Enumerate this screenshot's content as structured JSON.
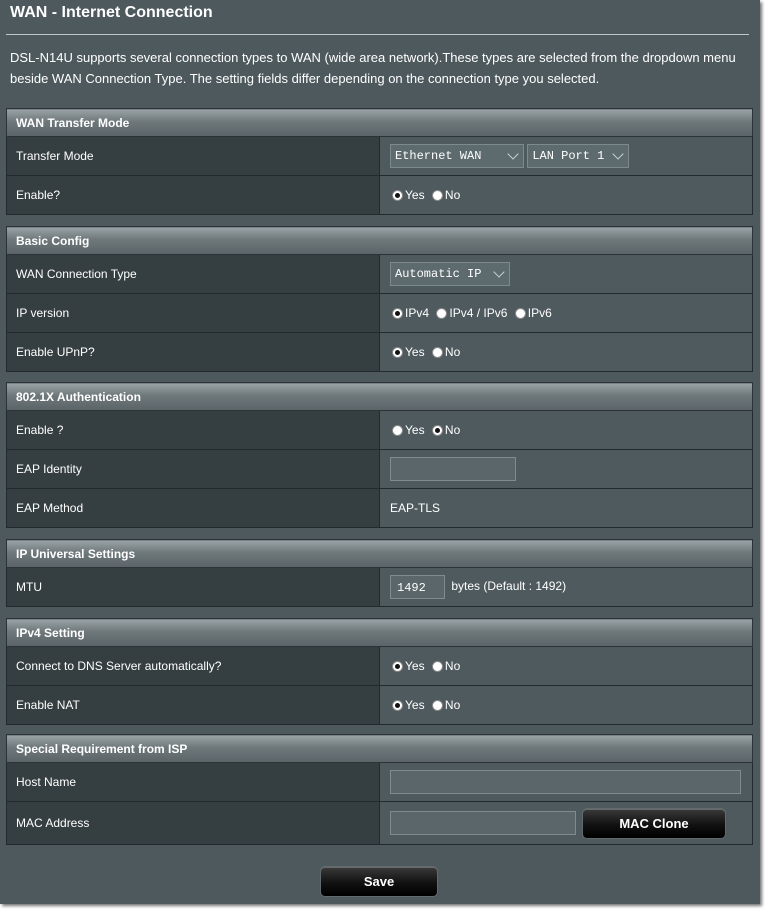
{
  "page": {
    "title": "WAN - Internet Connection",
    "description": "DSL-N14U supports several connection types to WAN (wide area network).These types are selected from the dropdown menu beside WAN Connection Type. The setting fields differ depending on the connection type you selected."
  },
  "wan_transfer_mode": {
    "header": "WAN Transfer Mode",
    "transfer_mode_label": "Transfer Mode",
    "transfer_mode_value": "Ethernet WAN",
    "port_value": "LAN Port 1",
    "enable_label": "Enable?",
    "enable_selected": "Yes"
  },
  "basic_config": {
    "header": "Basic Config",
    "wan_type_label": "WAN Connection Type",
    "wan_type_value": "Automatic IP",
    "ip_version_label": "IP version",
    "ip_version_selected": "IPv4",
    "upnp_label": "Enable UPnP?",
    "upnp_selected": "Yes"
  },
  "auth_8021x": {
    "header": "802.1X Authentication",
    "enable_label": "Enable ?",
    "enable_selected": "No",
    "eap_identity_label": "EAP Identity",
    "eap_identity_value": "",
    "eap_method_label": "EAP Method",
    "eap_method_value": "EAP-TLS"
  },
  "ip_universal": {
    "header": "IP Universal Settings",
    "mtu_label": "MTU",
    "mtu_value": "1492",
    "mtu_hint": "bytes (Default : 1492)"
  },
  "ipv4_setting": {
    "header": "IPv4 Setting",
    "dns_auto_label": "Connect to DNS Server automatically?",
    "dns_auto_selected": "Yes",
    "nat_label": "Enable NAT",
    "nat_selected": "Yes"
  },
  "isp": {
    "header": "Special Requirement from ISP",
    "host_name_label": "Host Name",
    "host_name_value": "",
    "mac_label": "MAC Address",
    "mac_value": "",
    "mac_clone_label": "MAC Clone"
  },
  "radio_options": {
    "yes": "Yes",
    "no": "No",
    "ipv4": "IPv4",
    "ipv4_ipv6": "IPv4 / IPv6",
    "ipv6": "IPv6"
  },
  "save_label": "Save"
}
